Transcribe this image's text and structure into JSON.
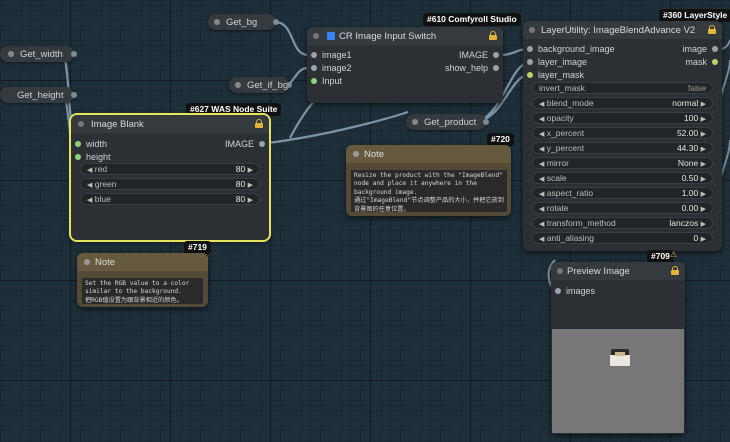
{
  "pills": {
    "get_bg": "Get_bg",
    "get_width": "Get_width",
    "get_height": "Get_height",
    "get_if_bg": "Get_if_bg",
    "get_product": "Get_product"
  },
  "cr_switch": {
    "badge": "#610 Comfyroll Studio",
    "title": "CR Image Input Switch",
    "inputs": [
      "image1",
      "image2",
      "Input"
    ],
    "outputs": [
      "IMAGE",
      "show_help"
    ]
  },
  "image_blank": {
    "badge": "#627 WAS Node Suite",
    "title": "Image Blank",
    "inputs": [
      "width",
      "height"
    ],
    "output": "IMAGE",
    "widgets": [
      {
        "label": "red",
        "value": "80"
      },
      {
        "label": "green",
        "value": "80"
      },
      {
        "label": "blue",
        "value": "80"
      }
    ]
  },
  "layer_style": {
    "badge": "#360 LayerStyle",
    "title": "LayerUtility: ImageBlendAdvance V2",
    "inputs": [
      "background_image",
      "layer_image",
      "layer_mask"
    ],
    "outputs": [
      "image",
      "mask"
    ],
    "widgets": [
      {
        "label": "invert_mask",
        "value": "false"
      },
      {
        "label": "blend_mode",
        "value": "normal"
      },
      {
        "label": "opacity",
        "value": "100"
      },
      {
        "label": "x_percent",
        "value": "52.00"
      },
      {
        "label": "y_percent",
        "value": "44.30"
      },
      {
        "label": "mirror",
        "value": "None"
      },
      {
        "label": "scale",
        "value": "0.50"
      },
      {
        "label": "aspect_ratio",
        "value": "1.00"
      },
      {
        "label": "rotate",
        "value": "0.00"
      },
      {
        "label": "transform_method",
        "value": "lanczos"
      },
      {
        "label": "anti_aliasing",
        "value": "0"
      }
    ]
  },
  "note_720": {
    "badge": "#720",
    "title": "Note",
    "text": "Resize the product with the \"ImageBlend\"\nnode and place it anywhere in the\nbackground image.\n通过\"ImageBlend\"节点调整产品的大小，并把它放到\n背景图的任意位置。"
  },
  "note_719": {
    "badge": "#719",
    "title": "Note",
    "text": "Set the RGB value to a color\nsimilar to the background.\n把RGB值设置为跟背景相近的颜色。"
  },
  "preview": {
    "badge": "#709",
    "title": "Preview Image",
    "input": "images"
  },
  "colors": {
    "canvas": "#1f2f3a",
    "node_body": "#2c2f33",
    "selected_outline": "#e6e45a",
    "lock": "#e0b53a",
    "note_body": "#544a35"
  }
}
